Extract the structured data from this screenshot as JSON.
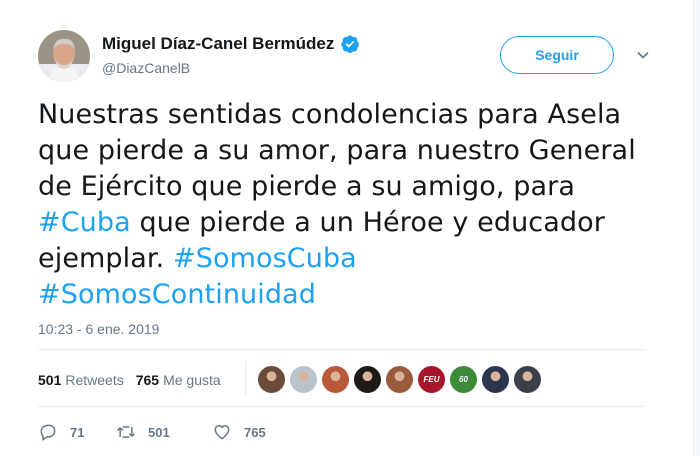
{
  "author": {
    "display_name": "Miguel Díaz-Canel Bermúdez",
    "handle": "@DiazCanelB",
    "verified": true
  },
  "follow_button": {
    "label": "Seguir"
  },
  "tweet": {
    "lines": [
      [
        {
          "t": "Nuestras sentidas condolencias para Asela",
          "tag": false
        }
      ],
      [
        {
          "t": "que pierde a su amor,  para nuestro General",
          "tag": false
        }
      ],
      [
        {
          "t": "de Ejército que pierde a su amigo, para",
          "tag": false
        }
      ],
      [
        {
          "t": "#Cuba",
          "tag": true
        },
        {
          "t": " que pierde a un Héroe y educador",
          "tag": false
        }
      ],
      [
        {
          "t": "ejemplar. ",
          "tag": false
        },
        {
          "t": "#SomosCuba",
          "tag": true
        }
      ],
      [
        {
          "t": "#SomosContinuidad",
          "tag": true
        }
      ]
    ],
    "timestamp": "10:23 - 6 ene. 2019"
  },
  "stats": {
    "retweets_count": "501",
    "retweets_label": "Retweets",
    "likes_count": "765",
    "likes_label": "Me gusta"
  },
  "liker_avatars": [
    {
      "name": "liker-avatar-1",
      "color": "#6b4b3a"
    },
    {
      "name": "liker-avatar-2",
      "color": "#b9c3cc"
    },
    {
      "name": "liker-avatar-3",
      "color": "#b85a3a"
    },
    {
      "name": "liker-avatar-4",
      "color": "#1e1b17"
    },
    {
      "name": "liker-avatar-5",
      "color": "#9a5a3c"
    },
    {
      "name": "liker-avatar-6",
      "color": "#a8162c",
      "text": "FEU"
    },
    {
      "name": "liker-avatar-7",
      "color": "#3c8a3a",
      "text": "60"
    },
    {
      "name": "liker-avatar-8",
      "color": "#2a3550"
    },
    {
      "name": "liker-avatar-9",
      "color": "#3a3f4a"
    }
  ],
  "actions": {
    "reply_count": "71",
    "retweet_count": "501",
    "like_count": "765"
  },
  "colors": {
    "accent": "#1da1f2",
    "text": "#14171a",
    "muted": "#657786",
    "divider": "#e6ecf0"
  }
}
